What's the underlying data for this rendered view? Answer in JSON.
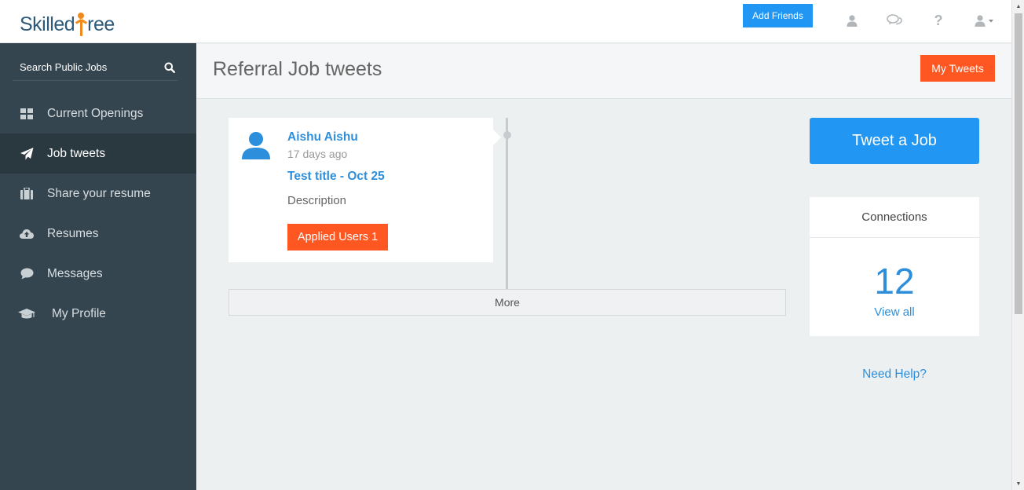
{
  "brand": {
    "logo_left": "Skilled",
    "logo_right": "ree"
  },
  "topbar": {
    "add_friends_label": "Add Friends",
    "icons": [
      "user-icon",
      "chat-icon",
      "help-icon",
      "account-dropdown-icon"
    ]
  },
  "sidebar": {
    "search_placeholder": "Search Public Jobs",
    "items": [
      {
        "label": "Current Openings",
        "icon": "grid-icon",
        "active": false
      },
      {
        "label": "Job tweets",
        "icon": "paper-plane-icon",
        "active": true
      },
      {
        "label": "Share your resume",
        "icon": "briefcase-icon",
        "active": false
      },
      {
        "label": "Resumes",
        "icon": "cloud-upload-icon",
        "active": false
      },
      {
        "label": "Messages",
        "icon": "speech-bubble-icon",
        "active": false
      },
      {
        "label": "My Profile",
        "icon": "graduation-cap-icon",
        "active": false
      }
    ]
  },
  "header": {
    "title": "Referral Job tweets",
    "my_tweets_label": "My Tweets"
  },
  "tweet": {
    "author": "Aishu Aishu",
    "time_ago": "17 days ago",
    "title": "Test title - Oct 25",
    "description": "Description",
    "applied_label": "Applied Users 1"
  },
  "timeline": {
    "more_label": "More"
  },
  "right": {
    "tweet_job_label": "Tweet a Job",
    "connections_title": "Connections",
    "connections_count": "12",
    "view_all_label": "View all",
    "need_help_label": "Need Help?"
  },
  "colors": {
    "primary_blue": "#2196f3",
    "accent_orange": "#ff5722",
    "link_blue": "#2d8fdc",
    "sidebar_bg": "#34454f",
    "sidebar_active_bg": "#2a383f",
    "logo_orange": "#f28a1b",
    "logo_navy": "#2d5a7b"
  }
}
